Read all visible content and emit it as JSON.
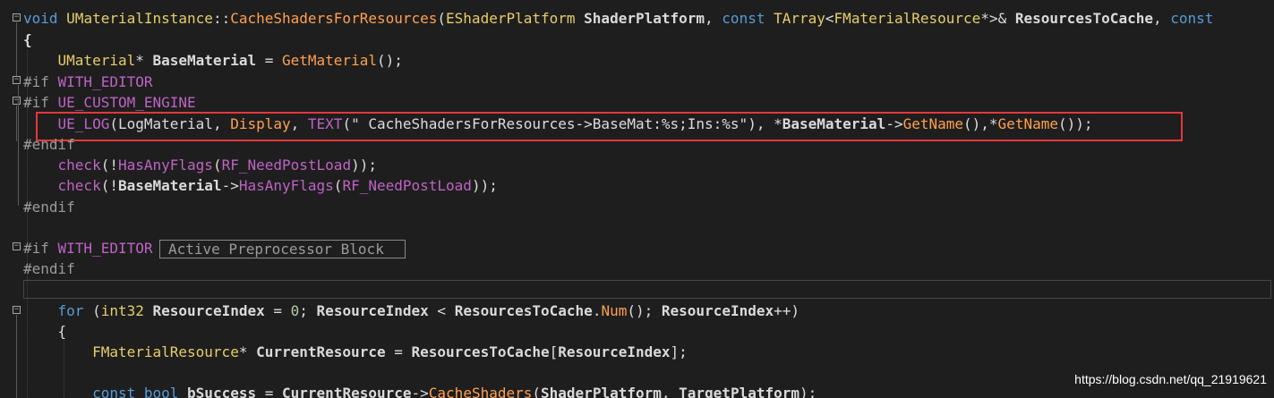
{
  "editor": {
    "line1": {
      "void": "void",
      "cls": "UMaterialInstance",
      "sep": "::",
      "fn": "CacheShadersForResources",
      "p1": "(",
      "t1": "EShaderPlatform",
      "a1": " ShaderPlatform",
      "c1": ", ",
      "const1": "const",
      "t2": " TArray",
      "lt": "<",
      "t3": "FMaterialResource",
      "ptr": "*>& ",
      "a2": "ResourcesToCache",
      "c2": ", ",
      "const2": "const"
    },
    "line2": {
      "brace": "{"
    },
    "line3": {
      "type": "UMaterial",
      "star": "* ",
      "var": "BaseMaterial",
      "eq": " = ",
      "fn": "GetMaterial",
      "tail": "();"
    },
    "line4": {
      "hash": "#if ",
      "macro": "WITH_EDITOR"
    },
    "line5": {
      "hash": "#if ",
      "macro": "UE_CUSTOM_ENGINE"
    },
    "line6": {
      "mac": "UE_LOG",
      "p1": "(",
      "cat": "LogMaterial",
      "c1": ", ",
      "verb": "Display",
      "c2": ", ",
      "text": "TEXT",
      "p2": "(",
      "str": "\" CacheShadersForResources->BaseMat:%s;Ins:%s\"",
      "p3": "), *",
      "var1": "BaseMaterial",
      "arrow": "->",
      "fn1": "GetName",
      "mid": "(),*",
      "fn2": "GetName",
      "tail": "());"
    },
    "line7": {
      "endif": "#endif"
    },
    "line8": {
      "fn": "check",
      "p1": "(!",
      "fn2": "HasAnyFlags",
      "p2": "(",
      "flag": "RF_NeedPostLoad",
      "tail": "));"
    },
    "line9": {
      "fn": "check",
      "p1": "(!",
      "var": "BaseMaterial",
      "arrow": "->",
      "fn2": "HasAnyFlags",
      "p2": "(",
      "flag": "RF_NeedPostLoad",
      "tail": "));"
    },
    "line10": {
      "endif": "#endif"
    },
    "line12": {
      "hash": "#if ",
      "macro": "WITH_EDITOR",
      "collapsed": "Active Preprocessor Block"
    },
    "line13": {
      "endif": "#endif"
    },
    "line15": {
      "for": "for",
      "p1": " (",
      "int": "int32",
      "var1": " ResourceIndex",
      "eq": " = ",
      "zero": "0",
      "semi": "; ",
      "var2": "ResourceIndex",
      "lt": " < ",
      "arr": "ResourcesToCache",
      "dot": ".",
      "num": "Num",
      "semi2": "(); ",
      "var3": "ResourceIndex",
      "tail": "++)"
    },
    "line16": {
      "brace": "{"
    },
    "line17": {
      "type": "FMaterialResource",
      "star": "* ",
      "var": "CurrentResource",
      "eq": " = ",
      "arr": "ResourcesToCache",
      "b1": "[",
      "idx": "ResourceIndex",
      "tail": "];"
    },
    "line19": {
      "const": "const",
      "bool": " bool",
      "var": " bSuccess",
      "eq": " = ",
      "obj": "CurrentResource",
      "arrow": "->",
      "fn": "CacheShaders",
      "p1": "(",
      "a1": "ShaderPlatform",
      "c1": ", ",
      "a2": "TargetPlatform",
      "tail": ");"
    }
  },
  "watermark": "https://blog.csdn.net/qq_21919621",
  "colors": {
    "background": "#1e1e1e",
    "keyword": "#569cd6",
    "class": "#e6cd69",
    "function": "#ffa050",
    "macro": "#be63c5",
    "string": "#d69d85",
    "highlight_border": "#e5383b"
  }
}
